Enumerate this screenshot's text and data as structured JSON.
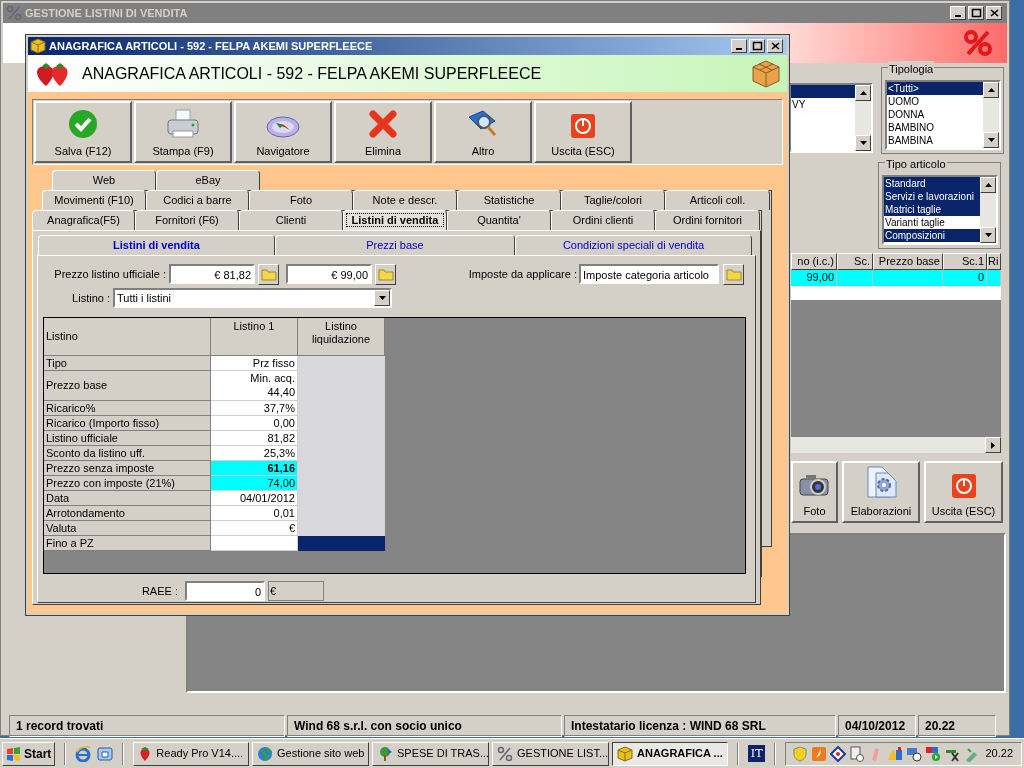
{
  "background_window": {
    "title": "GESTIONE LISTINI DI VENDITA",
    "filter_list": {
      "items": [
        {
          "selected": true
        },
        {
          "label": "VY",
          "selected": false
        }
      ]
    },
    "tipologia": {
      "label": "Tipologia",
      "items": [
        {
          "label": "<Tutti>",
          "selected": true
        },
        {
          "label": "UOMO",
          "selected": false
        },
        {
          "label": "DONNA",
          "selected": false
        },
        {
          "label": "BAMBINO",
          "selected": false
        },
        {
          "label": "BAMBINA",
          "selected": false
        }
      ]
    },
    "tipo_articolo": {
      "label": "Tipo articolo",
      "items": [
        {
          "label": "Standard",
          "selected": true
        },
        {
          "label": "Servizi e lavorazioni",
          "selected": true
        },
        {
          "label": "Matrici taglie",
          "selected": true
        },
        {
          "label": "Varianti taglie",
          "selected": false
        },
        {
          "label": "Composizioni",
          "selected": true
        }
      ]
    },
    "grid": {
      "columns": [
        "no (i.c.)",
        "Sc.",
        "Prezzo base",
        "Sc.1",
        "Ri"
      ],
      "rows": [
        {
          "selected": true,
          "cells": {
            "column_1": "99,00",
            "column_4": "0"
          }
        }
      ]
    },
    "buttons": [
      {
        "kind": "camera",
        "label": "Foto"
      },
      {
        "kind": "settings",
        "label": "Elaborazioni"
      },
      {
        "kind": "exit",
        "label": "Uscita (ESC)"
      }
    ],
    "status_bar": [
      "1 record trovati",
      "Wind 68 s.r.l. con socio unico",
      "Intestatario licenza : WIND 68 SRL",
      "04/10/2012",
      "20.22"
    ]
  },
  "item_window": {
    "title": "ANAGRAFICA ARTICOLI - 592 - FELPA AKEMI SUPERFLEECE",
    "header_title": "ANAGRAFICA ARTICOLI - 592 - FELPA AKEMI SUPERFLEECE",
    "toolbar": [
      {
        "kind": "save",
        "label": "Salva (F12)"
      },
      {
        "kind": "print",
        "label": "Stampa (F9)"
      },
      {
        "kind": "navigator",
        "label": "Navigatore"
      },
      {
        "kind": "delete",
        "label": "Elimina"
      },
      {
        "kind": "more",
        "label": "Altro"
      },
      {
        "kind": "exit",
        "label": "Uscita (ESC)"
      }
    ],
    "tab_rows": [
      [
        {
          "label": "Web",
          "selected": false
        },
        {
          "label": "eBay",
          "selected": false
        }
      ],
      [
        {
          "label": "Movimenti (F10)",
          "selected": false
        },
        {
          "label": "Codici a barre",
          "selected": false
        },
        {
          "label": "Foto",
          "selected": false
        },
        {
          "label": "Note e descr.",
          "selected": false
        },
        {
          "label": "Statistiche",
          "selected": false
        },
        {
          "label": "Taglie/colori",
          "selected": false
        },
        {
          "label": "Articoli coll.",
          "selected": false
        }
      ],
      [
        {
          "label": "Anagrafica(F5)",
          "selected": false
        },
        {
          "label": "Fornitori (F6)",
          "selected": false
        },
        {
          "label": "Clienti",
          "selected": false
        },
        {
          "label": "Listini di vendita",
          "selected": true
        },
        {
          "label": "Quantita'",
          "selected": false
        },
        {
          "label": "Ordini clienti",
          "selected": false
        },
        {
          "label": "Ordini fornitori",
          "selected": false
        }
      ]
    ],
    "subtabs": [
      {
        "label": "Listini di vendita",
        "selected": true
      },
      {
        "label": "Prezzi base",
        "selected": false
      },
      {
        "label": "Condizioni speciali di vendita",
        "selected": false
      }
    ],
    "prezzo_listino_ufficiale": {
      "label": "Prezzo listino ufficiale :",
      "values": [
        "€ 81,82",
        "€ 99,00"
      ]
    },
    "imposte": {
      "label": "Imposte da applicare :",
      "value": "Imposte categoria articolo"
    },
    "listino": {
      "label": "Listino :",
      "value": "Tutti i listini"
    },
    "table": {
      "columns": [
        "Listino",
        "Listino 1",
        "Listino liquidazione"
      ],
      "rows": [
        {
          "label": "Tipo",
          "value": "Prz fisso",
          "highlighted": false,
          "emphasized": false,
          "selected": false
        },
        {
          "label": "Prezzo base",
          "note": "Min. acq.",
          "value": "44,40",
          "highlighted": false,
          "emphasized": false,
          "selected": false
        },
        {
          "label": "Ricarico%",
          "value": "37,7%",
          "highlighted": false,
          "emphasized": false,
          "selected": false
        },
        {
          "label": "Ricarico (Importo fisso)",
          "value": "0,00",
          "highlighted": false,
          "emphasized": false,
          "selected": false
        },
        {
          "label": "Listino ufficiale",
          "value": "81,82",
          "highlighted": false,
          "emphasized": false,
          "selected": false
        },
        {
          "label": "Sconto da listino uff.",
          "value": "25,3%",
          "highlighted": false,
          "emphasized": false,
          "selected": false
        },
        {
          "label": "Prezzo senza imposte",
          "value": "61,16",
          "highlighted": true,
          "emphasized": true,
          "selected": false
        },
        {
          "label": "Prezzo con imposte (21%)",
          "value": "74,00",
          "highlighted": true,
          "emphasized": false,
          "selected": false
        },
        {
          "label": "Data",
          "value": "04/01/2012",
          "highlighted": false,
          "emphasized": false,
          "selected": false
        },
        {
          "label": "Arrotondamento",
          "value": "0,01",
          "highlighted": false,
          "emphasized": false,
          "selected": false
        },
        {
          "label": "Valuta",
          "value": "€",
          "highlighted": false,
          "emphasized": false,
          "selected": false
        },
        {
          "label": "Fino a PZ",
          "highlighted": false,
          "emphasized": false,
          "selected": true
        }
      ]
    },
    "raee": {
      "label": "RAEE :",
      "value": "0",
      "unit": "€"
    }
  },
  "taskbar": {
    "start": "Start",
    "tasks": [
      {
        "kind": "strawberry",
        "label": "Ready Pro V14....",
        "selected": false
      },
      {
        "kind": "globe",
        "label": "Gestione sito web",
        "selected": false
      },
      {
        "kind": "tree",
        "label": "SPESE DI TRAS...",
        "selected": false
      },
      {
        "kind": "percent",
        "label": "GESTIONE LIST...",
        "selected": false
      },
      {
        "kind": "cube",
        "label": "ANAGRAFICA ...",
        "selected": true
      }
    ],
    "language": "IT",
    "clock": "20.22"
  }
}
